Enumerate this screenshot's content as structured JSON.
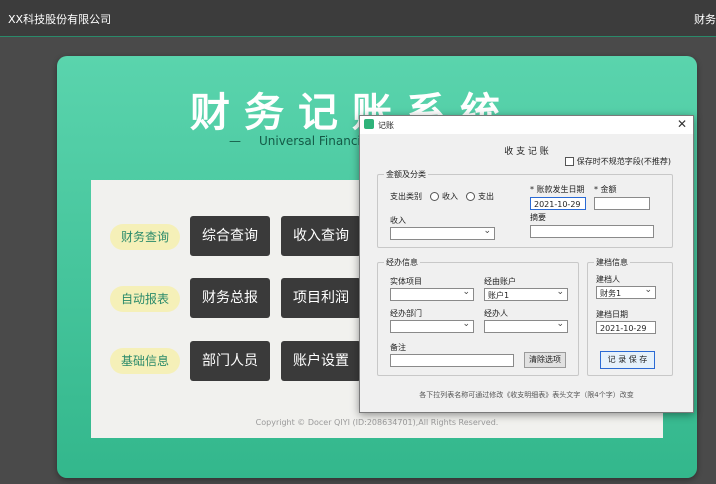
{
  "topbar": {
    "company": "XX科技股份有限公司",
    "right_text": "财务"
  },
  "app": {
    "title": "财务记账系统",
    "subtitle": "Universal Financi"
  },
  "tags": {
    "finance_query": "财务查询",
    "auto_report": "自动报表",
    "base_info": "基础信息"
  },
  "buttons": {
    "summary_query": "综合查询",
    "income_query": "收入查询",
    "finance_summary": "财务总报",
    "project_profit": "项目利润",
    "department_staff": "部门人员",
    "account_settings": "账户设置"
  },
  "copyright": "Copyright © Docer QIYI (ID:208634701),All Rights Reserved.",
  "dialog": {
    "title": "记账",
    "close": "✕",
    "header": "收 支 记 账",
    "checkbox_label": "保存时不规范字段(不推荐)",
    "amount_group": {
      "title": "金额及分类",
      "type_label": "支出类别",
      "radio_income": "收入",
      "radio_expense": "支出",
      "date_label": "* 账款发生日期",
      "date_value": "2021-10-29",
      "amount_label": "* 金额",
      "amount_value": "",
      "category_label": "收入",
      "category_value": "",
      "summary_label": "摘要",
      "summary_value": ""
    },
    "handler_group": {
      "title": "经办信息",
      "entity_label": "实体项目",
      "entity_value": "",
      "account_label": "经由账户",
      "account_value": "账户1",
      "dept_label": "经办部门",
      "dept_value": "",
      "handler_label": "经办人",
      "handler_value": "",
      "remark_label": "备注",
      "remark_value": "",
      "clear_button": "清除选项"
    },
    "builder_group": {
      "title": "建档信息",
      "builder_label": "建档人",
      "builder_value": "财务1",
      "build_date_label": "建档日期",
      "build_date_value": "2021-10-29",
      "save_button": "记 录 保 存"
    },
    "footnote": "各下拉列表名称可通过修改《收支明细表》表头文字（限4个字）改变"
  }
}
